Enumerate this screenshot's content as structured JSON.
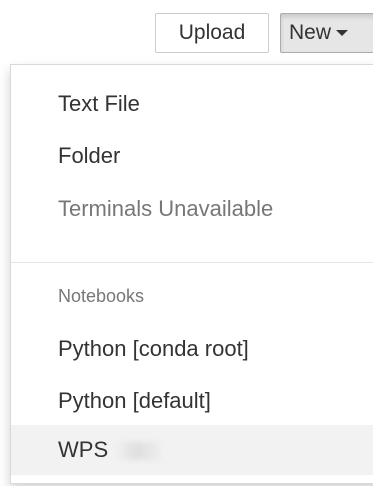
{
  "toolbar": {
    "upload_label": "Upload",
    "new_label": "New"
  },
  "menu": {
    "items": [
      {
        "label": "Text File",
        "state": "enabled"
      },
      {
        "label": "Folder",
        "state": "enabled"
      },
      {
        "label": "Terminals Unavailable",
        "state": "disabled"
      }
    ],
    "notebooks_header": "Notebooks",
    "kernels": [
      {
        "label": "Python [conda root]"
      },
      {
        "label": "Python [default]"
      },
      {
        "label": "WPS",
        "highlighted": true
      }
    ]
  },
  "colors": {
    "text": "#333333",
    "muted": "#777777",
    "hover_bg": "#f2f2f2",
    "active_button_bg": "#e6e6e6"
  },
  "icons": {
    "new_dropdown": "caret-down-icon"
  }
}
